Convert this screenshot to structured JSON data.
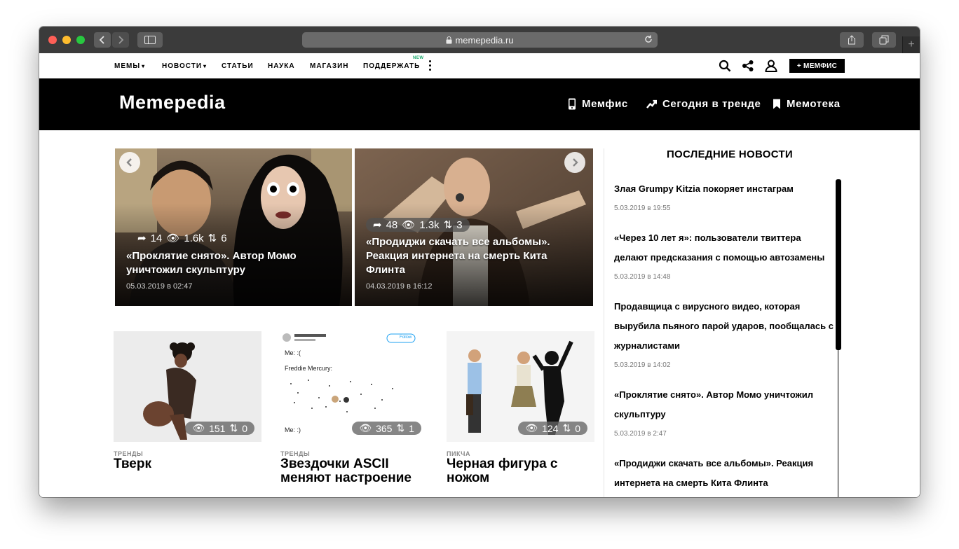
{
  "browser": {
    "url": "memepedia.ru",
    "new_tab_symbol": "+"
  },
  "topnav": {
    "items": [
      {
        "label": "МЕМЫ",
        "dropdown": true
      },
      {
        "label": "НОВОСТИ",
        "dropdown": true
      },
      {
        "label": "СТАТЬИ",
        "dropdown": false
      },
      {
        "label": "НАУКА",
        "dropdown": false
      },
      {
        "label": "МАГАЗИН",
        "dropdown": false
      },
      {
        "label": "ПОДДЕРЖАТЬ",
        "dropdown": false
      }
    ],
    "new_badge": "NEW",
    "memfis_button": "+ МЕМФИС",
    "chevron": "⌄"
  },
  "header": {
    "logo": "Memepedia",
    "links": [
      {
        "label": "Мемфис",
        "icon": "phone-icon"
      },
      {
        "label": "Сегодня в тренде",
        "icon": "trend-icon"
      },
      {
        "label": "Мемотека",
        "icon": "bookmark-icon"
      }
    ]
  },
  "slider": [
    {
      "shares": "14",
      "views": "1.6k",
      "votes": "6",
      "title": "«Проклятие снято». Автор Момо уничтожил скульптуру",
      "date": "05.03.2019 в 02:47"
    },
    {
      "shares": "48",
      "views": "1.3k",
      "votes": "3",
      "title": "«Продиджи скачать все альбомы». Реакция интернета на смерть Кита Флинта",
      "date": "04.03.2019 в 16:12"
    }
  ],
  "cards": [
    {
      "category": "ТРЕНДЫ",
      "title": "Тверк",
      "views": "151",
      "votes": "0"
    },
    {
      "category": "ТРЕНДЫ",
      "title": "Звездочки ASCII меняют настроение",
      "views": "365",
      "votes": "1",
      "tweet": {
        "line1": "Me: :(",
        "line2": "Freddie Mercury:",
        "line3": "Me: :)",
        "follow": "Follow"
      }
    },
    {
      "category": "ПИКЧА",
      "title": "Черная фигура с ножом",
      "views": "124",
      "votes": "0"
    }
  ],
  "sidebar": {
    "title": "ПОСЛЕДНИЕ НОВОСТИ",
    "items": [
      {
        "title": "Злая Grumpy Kitzia покоряет инстаграм",
        "date": "5.03.2019 в 19:55"
      },
      {
        "title": "«Через 10 лет я»: пользователи твиттера делают предсказания с помощью автозамены",
        "date": "5.03.2019 в 14:48"
      },
      {
        "title": "Продавщица с вирусного видео, которая вырубила пьяного парой ударов, пообщалась с журналистами",
        "date": "5.03.2019 в 14:02"
      },
      {
        "title": "«Проклятие снято». Автор Момо уничтожил скульптуру",
        "date": "5.03.2019 в 2:47"
      },
      {
        "title": "«Продиджи скачать все альбомы». Реакция интернета на смерть Кита Флинта",
        "date": ""
      }
    ]
  },
  "colors": {
    "header_bg": "#000000",
    "badge_green": "#1aa86b",
    "titlebar": "#3b3b3b"
  }
}
